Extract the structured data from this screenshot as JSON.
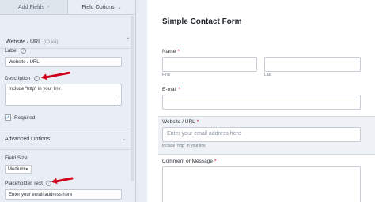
{
  "tabs": {
    "add_fields": "Add Fields",
    "add_fields_icon": "chevron-right-icon",
    "field_options": "Field Options",
    "field_options_icon": "chevron-down-icon"
  },
  "field_section": {
    "title": "Website / URL",
    "id_label": "(ID #4)"
  },
  "label_field": {
    "label": "Label",
    "value": "Website / URL"
  },
  "description_field": {
    "label": "Description",
    "value": "Include \"http\" in your link"
  },
  "required": {
    "label": "Required",
    "checked": true
  },
  "advanced": {
    "title": "Advanced Options"
  },
  "field_size": {
    "label": "Field Size",
    "value": "Medium"
  },
  "placeholder_field": {
    "label": "Placeholder Text",
    "value": "Enter your email address here"
  },
  "preview": {
    "title": "Simple Contact Form",
    "name_label": "Name",
    "first_label": "First",
    "last_label": "Last",
    "email_label": "E-mail",
    "website_label": "Website / URL",
    "website_placeholder": "Enter your email address here",
    "website_description": "Include \"http\" in your link",
    "comment_label": "Comment or Message",
    "required_marker": "*"
  },
  "colors": {
    "annotation_arrow": "#d0021b",
    "panel_bg": "#e9eef4",
    "required_star": "#d0021b"
  }
}
